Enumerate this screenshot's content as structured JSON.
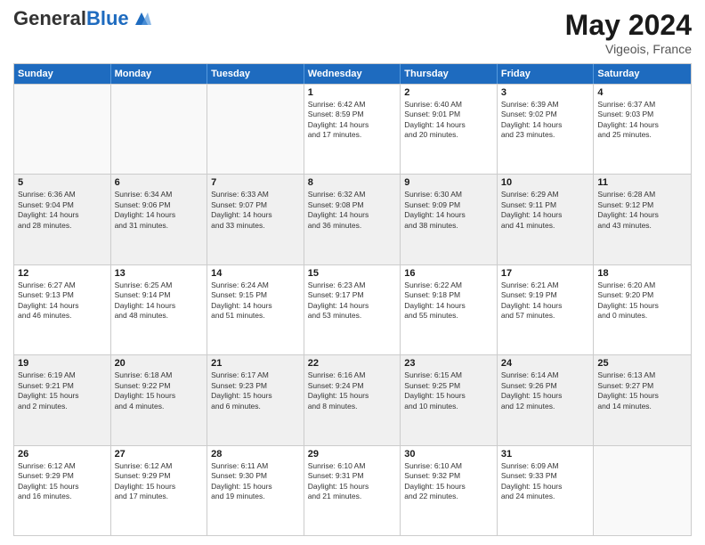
{
  "header": {
    "logo_general": "General",
    "logo_blue": "Blue",
    "month_year": "May 2024",
    "location": "Vigeois, France"
  },
  "days_of_week": [
    "Sunday",
    "Monday",
    "Tuesday",
    "Wednesday",
    "Thursday",
    "Friday",
    "Saturday"
  ],
  "weeks": [
    [
      {
        "day": "",
        "info": ""
      },
      {
        "day": "",
        "info": ""
      },
      {
        "day": "",
        "info": ""
      },
      {
        "day": "1",
        "info": "Sunrise: 6:42 AM\nSunset: 8:59 PM\nDaylight: 14 hours\nand 17 minutes."
      },
      {
        "day": "2",
        "info": "Sunrise: 6:40 AM\nSunset: 9:01 PM\nDaylight: 14 hours\nand 20 minutes."
      },
      {
        "day": "3",
        "info": "Sunrise: 6:39 AM\nSunset: 9:02 PM\nDaylight: 14 hours\nand 23 minutes."
      },
      {
        "day": "4",
        "info": "Sunrise: 6:37 AM\nSunset: 9:03 PM\nDaylight: 14 hours\nand 25 minutes."
      }
    ],
    [
      {
        "day": "5",
        "info": "Sunrise: 6:36 AM\nSunset: 9:04 PM\nDaylight: 14 hours\nand 28 minutes."
      },
      {
        "day": "6",
        "info": "Sunrise: 6:34 AM\nSunset: 9:06 PM\nDaylight: 14 hours\nand 31 minutes."
      },
      {
        "day": "7",
        "info": "Sunrise: 6:33 AM\nSunset: 9:07 PM\nDaylight: 14 hours\nand 33 minutes."
      },
      {
        "day": "8",
        "info": "Sunrise: 6:32 AM\nSunset: 9:08 PM\nDaylight: 14 hours\nand 36 minutes."
      },
      {
        "day": "9",
        "info": "Sunrise: 6:30 AM\nSunset: 9:09 PM\nDaylight: 14 hours\nand 38 minutes."
      },
      {
        "day": "10",
        "info": "Sunrise: 6:29 AM\nSunset: 9:11 PM\nDaylight: 14 hours\nand 41 minutes."
      },
      {
        "day": "11",
        "info": "Sunrise: 6:28 AM\nSunset: 9:12 PM\nDaylight: 14 hours\nand 43 minutes."
      }
    ],
    [
      {
        "day": "12",
        "info": "Sunrise: 6:27 AM\nSunset: 9:13 PM\nDaylight: 14 hours\nand 46 minutes."
      },
      {
        "day": "13",
        "info": "Sunrise: 6:25 AM\nSunset: 9:14 PM\nDaylight: 14 hours\nand 48 minutes."
      },
      {
        "day": "14",
        "info": "Sunrise: 6:24 AM\nSunset: 9:15 PM\nDaylight: 14 hours\nand 51 minutes."
      },
      {
        "day": "15",
        "info": "Sunrise: 6:23 AM\nSunset: 9:17 PM\nDaylight: 14 hours\nand 53 minutes."
      },
      {
        "day": "16",
        "info": "Sunrise: 6:22 AM\nSunset: 9:18 PM\nDaylight: 14 hours\nand 55 minutes."
      },
      {
        "day": "17",
        "info": "Sunrise: 6:21 AM\nSunset: 9:19 PM\nDaylight: 14 hours\nand 57 minutes."
      },
      {
        "day": "18",
        "info": "Sunrise: 6:20 AM\nSunset: 9:20 PM\nDaylight: 15 hours\nand 0 minutes."
      }
    ],
    [
      {
        "day": "19",
        "info": "Sunrise: 6:19 AM\nSunset: 9:21 PM\nDaylight: 15 hours\nand 2 minutes."
      },
      {
        "day": "20",
        "info": "Sunrise: 6:18 AM\nSunset: 9:22 PM\nDaylight: 15 hours\nand 4 minutes."
      },
      {
        "day": "21",
        "info": "Sunrise: 6:17 AM\nSunset: 9:23 PM\nDaylight: 15 hours\nand 6 minutes."
      },
      {
        "day": "22",
        "info": "Sunrise: 6:16 AM\nSunset: 9:24 PM\nDaylight: 15 hours\nand 8 minutes."
      },
      {
        "day": "23",
        "info": "Sunrise: 6:15 AM\nSunset: 9:25 PM\nDaylight: 15 hours\nand 10 minutes."
      },
      {
        "day": "24",
        "info": "Sunrise: 6:14 AM\nSunset: 9:26 PM\nDaylight: 15 hours\nand 12 minutes."
      },
      {
        "day": "25",
        "info": "Sunrise: 6:13 AM\nSunset: 9:27 PM\nDaylight: 15 hours\nand 14 minutes."
      }
    ],
    [
      {
        "day": "26",
        "info": "Sunrise: 6:12 AM\nSunset: 9:29 PM\nDaylight: 15 hours\nand 16 minutes."
      },
      {
        "day": "27",
        "info": "Sunrise: 6:12 AM\nSunset: 9:29 PM\nDaylight: 15 hours\nand 17 minutes."
      },
      {
        "day": "28",
        "info": "Sunrise: 6:11 AM\nSunset: 9:30 PM\nDaylight: 15 hours\nand 19 minutes."
      },
      {
        "day": "29",
        "info": "Sunrise: 6:10 AM\nSunset: 9:31 PM\nDaylight: 15 hours\nand 21 minutes."
      },
      {
        "day": "30",
        "info": "Sunrise: 6:10 AM\nSunset: 9:32 PM\nDaylight: 15 hours\nand 22 minutes."
      },
      {
        "day": "31",
        "info": "Sunrise: 6:09 AM\nSunset: 9:33 PM\nDaylight: 15 hours\nand 24 minutes."
      },
      {
        "day": "",
        "info": ""
      }
    ]
  ]
}
